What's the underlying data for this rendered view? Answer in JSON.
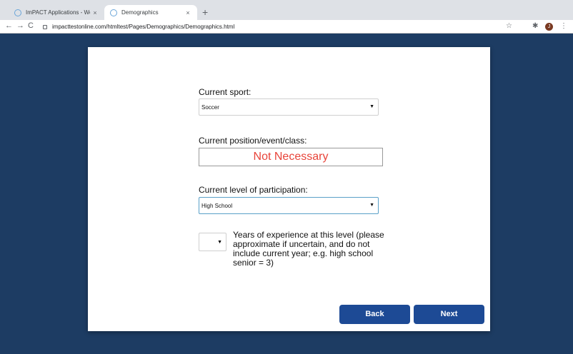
{
  "browser": {
    "tabs": [
      {
        "label": "ImPACT Applications - Welcom",
        "close": "×",
        "active": false
      },
      {
        "label": "Demographics",
        "close": "×",
        "active": true
      }
    ],
    "new_tab": "+",
    "nav": {
      "back": "←",
      "forward": "→",
      "reload": "C"
    },
    "url": "impacttestonline.com/htmltest/Pages/Demographics/Demographics.html",
    "toolbar_icons": {
      "bookmark": "☆",
      "extensions": "✱",
      "menu": "⋮"
    },
    "profile_initial": "J"
  },
  "form": {
    "sport": {
      "label": "Current sport:",
      "value": "Soccer"
    },
    "position": {
      "label": "Current position/event/class:",
      "value": "Not Necessary"
    },
    "level": {
      "label": "Current level of participation:",
      "value": "High School"
    },
    "years": {
      "value": "",
      "label": "Years of experience at this level (please approximate if uncertain, and do not include current year; e.g. high school senior = 3)"
    }
  },
  "buttons": {
    "back": "Back",
    "next": "Next"
  },
  "colors": {
    "background": "#1d3c63",
    "button": "#1d4a95",
    "not_necessary": "#e8443a"
  }
}
